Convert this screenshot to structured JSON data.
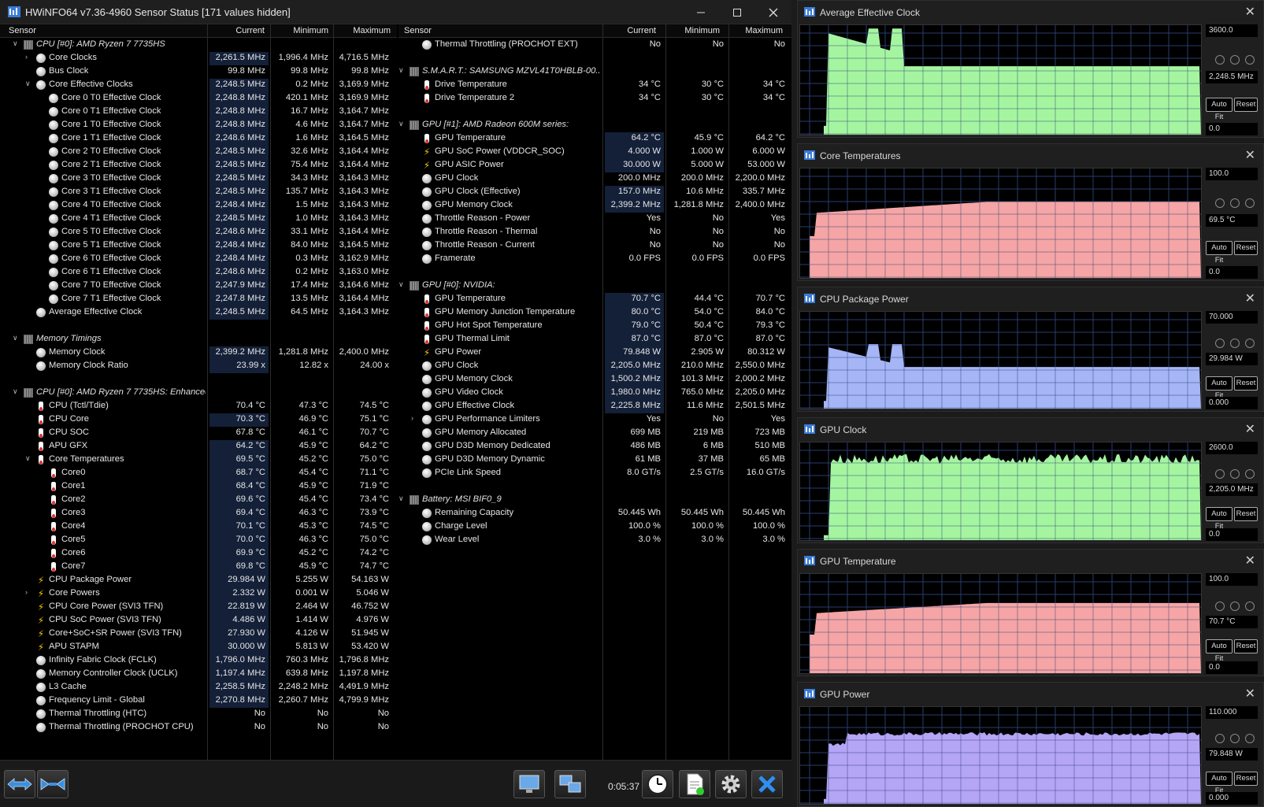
{
  "window": {
    "title": "HWiNFO64 v7.36-4960 Sensor Status [171 values hidden]",
    "icons": {
      "app": "hwinfo-icon",
      "minimize": "minimize-icon",
      "maximize": "maximize-icon",
      "close": "close-icon"
    }
  },
  "columns": {
    "sensor": "Sensor",
    "current": "Current",
    "minimum": "Minimum",
    "maximum": "Maximum"
  },
  "left_rows": [
    {
      "indent": 0,
      "expand": "down",
      "icon": "chip",
      "label": "CPU [#0]: AMD Ryzen 7 7735HS",
      "group": true
    },
    {
      "indent": 1,
      "expand": "right",
      "icon": "circle",
      "label": "Core Clocks",
      "cur": "2,261.5 MHz",
      "min": "1,996.4 MHz",
      "max": "4,716.5 MHz",
      "hl": true
    },
    {
      "indent": 1,
      "icon": "circle",
      "label": "Bus Clock",
      "cur": "99.8 MHz",
      "min": "99.8 MHz",
      "max": "99.8 MHz"
    },
    {
      "indent": 1,
      "expand": "down",
      "icon": "circle",
      "label": "Core Effective Clocks",
      "cur": "2,248.5 MHz",
      "min": "0.2 MHz",
      "max": "3,169.9 MHz",
      "hl": true
    },
    {
      "indent": 2,
      "icon": "circle",
      "label": "Core 0 T0 Effective Clock",
      "cur": "2,248.8 MHz",
      "min": "420.1 MHz",
      "max": "3,169.9 MHz",
      "hl": true
    },
    {
      "indent": 2,
      "icon": "circle",
      "label": "Core 0 T1 Effective Clock",
      "cur": "2,248.8 MHz",
      "min": "16.7 MHz",
      "max": "3,164.7 MHz",
      "hl": true
    },
    {
      "indent": 2,
      "icon": "circle",
      "label": "Core 1 T0 Effective Clock",
      "cur": "2,248.8 MHz",
      "min": "4.6 MHz",
      "max": "3,164.7 MHz",
      "hl": true
    },
    {
      "indent": 2,
      "icon": "circle",
      "label": "Core 1 T1 Effective Clock",
      "cur": "2,248.6 MHz",
      "min": "1.6 MHz",
      "max": "3,164.5 MHz",
      "hl": true
    },
    {
      "indent": 2,
      "icon": "circle",
      "label": "Core 2 T0 Effective Clock",
      "cur": "2,248.5 MHz",
      "min": "32.6 MHz",
      "max": "3,164.4 MHz",
      "hl": true
    },
    {
      "indent": 2,
      "icon": "circle",
      "label": "Core 2 T1 Effective Clock",
      "cur": "2,248.5 MHz",
      "min": "75.4 MHz",
      "max": "3,164.4 MHz",
      "hl": true
    },
    {
      "indent": 2,
      "icon": "circle",
      "label": "Core 3 T0 Effective Clock",
      "cur": "2,248.5 MHz",
      "min": "34.3 MHz",
      "max": "3,164.3 MHz",
      "hl": true
    },
    {
      "indent": 2,
      "icon": "circle",
      "label": "Core 3 T1 Effective Clock",
      "cur": "2,248.5 MHz",
      "min": "135.7 MHz",
      "max": "3,164.3 MHz",
      "hl": true
    },
    {
      "indent": 2,
      "icon": "circle",
      "label": "Core 4 T0 Effective Clock",
      "cur": "2,248.4 MHz",
      "min": "1.5 MHz",
      "max": "3,164.3 MHz",
      "hl": true
    },
    {
      "indent": 2,
      "icon": "circle",
      "label": "Core 4 T1 Effective Clock",
      "cur": "2,248.5 MHz",
      "min": "1.0 MHz",
      "max": "3,164.3 MHz",
      "hl": true
    },
    {
      "indent": 2,
      "icon": "circle",
      "label": "Core 5 T0 Effective Clock",
      "cur": "2,248.6 MHz",
      "min": "33.1 MHz",
      "max": "3,164.4 MHz",
      "hl": true
    },
    {
      "indent": 2,
      "icon": "circle",
      "label": "Core 5 T1 Effective Clock",
      "cur": "2,248.4 MHz",
      "min": "84.0 MHz",
      "max": "3,164.5 MHz",
      "hl": true
    },
    {
      "indent": 2,
      "icon": "circle",
      "label": "Core 6 T0 Effective Clock",
      "cur": "2,248.4 MHz",
      "min": "0.3 MHz",
      "max": "3,162.9 MHz",
      "hl": true
    },
    {
      "indent": 2,
      "icon": "circle",
      "label": "Core 6 T1 Effective Clock",
      "cur": "2,248.6 MHz",
      "min": "0.2 MHz",
      "max": "3,163.0 MHz",
      "hl": true
    },
    {
      "indent": 2,
      "icon": "circle",
      "label": "Core 7 T0 Effective Clock",
      "cur": "2,247.9 MHz",
      "min": "17.4 MHz",
      "max": "3,164.6 MHz",
      "hl": true
    },
    {
      "indent": 2,
      "icon": "circle",
      "label": "Core 7 T1 Effective Clock",
      "cur": "2,247.8 MHz",
      "min": "13.5 MHz",
      "max": "3,164.4 MHz",
      "hl": true
    },
    {
      "indent": 1,
      "icon": "circle",
      "label": "Average Effective Clock",
      "cur": "2,248.5 MHz",
      "min": "64.5 MHz",
      "max": "3,164.3 MHz",
      "hl": true
    },
    {
      "blank": true
    },
    {
      "indent": 0,
      "expand": "down",
      "icon": "chip",
      "label": "Memory Timings",
      "group": true
    },
    {
      "indent": 1,
      "icon": "circle",
      "label": "Memory Clock",
      "cur": "2,399.2 MHz",
      "min": "1,281.8 MHz",
      "max": "2,400.0 MHz",
      "hl": true
    },
    {
      "indent": 1,
      "icon": "circle",
      "label": "Memory Clock Ratio",
      "cur": "23.99 x",
      "min": "12.82 x",
      "max": "24.00 x",
      "hl": true
    },
    {
      "blank": true
    },
    {
      "indent": 0,
      "expand": "down",
      "icon": "chip",
      "label": "CPU [#0]: AMD Ryzen 7 7735HS: Enhanced",
      "group": true
    },
    {
      "indent": 1,
      "icon": "therm",
      "label": "CPU (Tctl/Tdie)",
      "cur": "70.4 °C",
      "min": "47.3 °C",
      "max": "74.5 °C"
    },
    {
      "indent": 1,
      "icon": "therm",
      "label": "CPU Core",
      "cur": "70.3 °C",
      "min": "46.9 °C",
      "max": "75.1 °C",
      "hl": true
    },
    {
      "indent": 1,
      "icon": "therm",
      "label": "CPU SOC",
      "cur": "67.8 °C",
      "min": "46.1 °C",
      "max": "70.7 °C"
    },
    {
      "indent": 1,
      "icon": "therm",
      "label": "APU GFX",
      "cur": "64.2 °C",
      "min": "45.9 °C",
      "max": "64.2 °C",
      "hl": true
    },
    {
      "indent": 1,
      "expand": "down",
      "icon": "therm",
      "label": "Core Temperatures",
      "cur": "69.5 °C",
      "min": "45.2 °C",
      "max": "75.0 °C",
      "hl": true
    },
    {
      "indent": 2,
      "icon": "therm",
      "label": "Core0",
      "cur": "68.7 °C",
      "min": "45.4 °C",
      "max": "71.1 °C",
      "hl": true
    },
    {
      "indent": 2,
      "icon": "therm",
      "label": "Core1",
      "cur": "68.4 °C",
      "min": "45.9 °C",
      "max": "71.9 °C",
      "hl": true
    },
    {
      "indent": 2,
      "icon": "therm",
      "label": "Core2",
      "cur": "69.6 °C",
      "min": "45.4 °C",
      "max": "73.4 °C",
      "hl": true
    },
    {
      "indent": 2,
      "icon": "therm",
      "label": "Core3",
      "cur": "69.4 °C",
      "min": "46.3 °C",
      "max": "73.9 °C",
      "hl": true
    },
    {
      "indent": 2,
      "icon": "therm",
      "label": "Core4",
      "cur": "70.1 °C",
      "min": "45.3 °C",
      "max": "74.5 °C",
      "hl": true
    },
    {
      "indent": 2,
      "icon": "therm",
      "label": "Core5",
      "cur": "70.0 °C",
      "min": "46.3 °C",
      "max": "75.0 °C",
      "hl": true
    },
    {
      "indent": 2,
      "icon": "therm",
      "label": "Core6",
      "cur": "69.9 °C",
      "min": "45.2 °C",
      "max": "74.2 °C",
      "hl": true
    },
    {
      "indent": 2,
      "icon": "therm",
      "label": "Core7",
      "cur": "69.8 °C",
      "min": "45.9 °C",
      "max": "74.7 °C",
      "hl": true
    },
    {
      "indent": 1,
      "icon": "bolt",
      "label": "CPU Package Power",
      "cur": "29.984 W",
      "min": "5.255 W",
      "max": "54.163 W",
      "hl": true
    },
    {
      "indent": 1,
      "expand": "right",
      "icon": "bolt",
      "label": "Core Powers",
      "cur": "2.332 W",
      "min": "0.001 W",
      "max": "5.046 W",
      "hl": true
    },
    {
      "indent": 1,
      "icon": "bolt",
      "label": "CPU Core Power (SVI3 TFN)",
      "cur": "22.819 W",
      "min": "2.464 W",
      "max": "46.752 W",
      "hl": true
    },
    {
      "indent": 1,
      "icon": "bolt",
      "label": "CPU SoC Power (SVI3 TFN)",
      "cur": "4.486 W",
      "min": "1.414 W",
      "max": "4.976 W",
      "hl": true
    },
    {
      "indent": 1,
      "icon": "bolt",
      "label": "Core+SoC+SR Power (SVI3 TFN)",
      "cur": "27.930 W",
      "min": "4.126 W",
      "max": "51.945 W",
      "hl": true
    },
    {
      "indent": 1,
      "icon": "bolt",
      "label": "APU STAPM",
      "cur": "30.000 W",
      "min": "5.813 W",
      "max": "53.420 W",
      "hl": true
    },
    {
      "indent": 1,
      "icon": "circle",
      "label": "Infinity Fabric Clock (FCLK)",
      "cur": "1,796.0 MHz",
      "min": "760.3 MHz",
      "max": "1,796.8 MHz",
      "hl": true
    },
    {
      "indent": 1,
      "icon": "circle",
      "label": "Memory Controller Clock (UCLK)",
      "cur": "1,197.4 MHz",
      "min": "639.8 MHz",
      "max": "1,197.8 MHz",
      "hl": true
    },
    {
      "indent": 1,
      "icon": "circle",
      "label": "L3 Cache",
      "cur": "2,258.5 MHz",
      "min": "2,248.2 MHz",
      "max": "4,491.9 MHz",
      "hl": true
    },
    {
      "indent": 1,
      "icon": "circle",
      "label": "Frequency Limit - Global",
      "cur": "2,270.8 MHz",
      "min": "2,260.7 MHz",
      "max": "4,799.9 MHz",
      "hl": true
    },
    {
      "indent": 1,
      "icon": "circle",
      "label": "Thermal Throttling (HTC)",
      "cur": "No",
      "min": "No",
      "max": "No"
    },
    {
      "indent": 1,
      "icon": "circle",
      "label": "Thermal Throttling (PROCHOT CPU)",
      "cur": "No",
      "min": "No",
      "max": "No"
    }
  ],
  "right_rows": [
    {
      "indent": 1,
      "icon": "circle",
      "label": "Thermal Throttling (PROCHOT EXT)",
      "cur": "No",
      "min": "No",
      "max": "No"
    },
    {
      "blank": true
    },
    {
      "indent": 0,
      "expand": "down",
      "icon": "chip",
      "label": "S.M.A.R.T.: SAMSUNG MZVL41T0HBLB-00...",
      "group": true
    },
    {
      "indent": 1,
      "icon": "therm",
      "label": "Drive Temperature",
      "cur": "34 °C",
      "min": "30 °C",
      "max": "34 °C"
    },
    {
      "indent": 1,
      "icon": "therm",
      "label": "Drive Temperature 2",
      "cur": "34 °C",
      "min": "30 °C",
      "max": "34 °C"
    },
    {
      "blank": true
    },
    {
      "indent": 0,
      "expand": "down",
      "icon": "chip",
      "label": "GPU [#1]: AMD Radeon 600M series:",
      "group": true
    },
    {
      "indent": 1,
      "icon": "therm",
      "label": "GPU Temperature",
      "cur": "64.2 °C",
      "min": "45.9 °C",
      "max": "64.2 °C",
      "hl": true
    },
    {
      "indent": 1,
      "icon": "bolt",
      "label": "GPU SoC Power (VDDCR_SOC)",
      "cur": "4.000 W",
      "min": "1.000 W",
      "max": "6.000 W",
      "hl": true
    },
    {
      "indent": 1,
      "icon": "bolt",
      "label": "GPU ASIC Power",
      "cur": "30.000 W",
      "min": "5.000 W",
      "max": "53.000 W",
      "hl": true
    },
    {
      "indent": 1,
      "icon": "circle",
      "label": "GPU Clock",
      "cur": "200.0 MHz",
      "min": "200.0 MHz",
      "max": "2,200.0 MHz"
    },
    {
      "indent": 1,
      "icon": "circle",
      "label": "GPU Clock (Effective)",
      "cur": "157.0 MHz",
      "min": "10.6 MHz",
      "max": "335.7 MHz",
      "hl": true
    },
    {
      "indent": 1,
      "icon": "circle",
      "label": "GPU Memory Clock",
      "cur": "2,399.2 MHz",
      "min": "1,281.8 MHz",
      "max": "2,400.0 MHz",
      "hl": true
    },
    {
      "indent": 1,
      "icon": "circle",
      "label": "Throttle Reason - Power",
      "cur": "Yes",
      "min": "No",
      "max": "Yes"
    },
    {
      "indent": 1,
      "icon": "circle",
      "label": "Throttle Reason - Thermal",
      "cur": "No",
      "min": "No",
      "max": "No"
    },
    {
      "indent": 1,
      "icon": "circle",
      "label": "Throttle Reason - Current",
      "cur": "No",
      "min": "No",
      "max": "No"
    },
    {
      "indent": 1,
      "icon": "circle",
      "label": "Framerate",
      "cur": "0.0 FPS",
      "min": "0.0 FPS",
      "max": "0.0 FPS"
    },
    {
      "blank": true
    },
    {
      "indent": 0,
      "expand": "down",
      "icon": "chip",
      "label": "GPU [#0]: NVIDIA:",
      "group": true
    },
    {
      "indent": 1,
      "icon": "therm",
      "label": "GPU Temperature",
      "cur": "70.7 °C",
      "min": "44.4 °C",
      "max": "70.7 °C",
      "hl": true
    },
    {
      "indent": 1,
      "icon": "therm",
      "label": "GPU Memory Junction Temperature",
      "cur": "80.0 °C",
      "min": "54.0 °C",
      "max": "84.0 °C",
      "hl": true
    },
    {
      "indent": 1,
      "icon": "therm",
      "label": "GPU Hot Spot Temperature",
      "cur": "79.0 °C",
      "min": "50.4 °C",
      "max": "79.3 °C",
      "hl": true
    },
    {
      "indent": 1,
      "icon": "therm",
      "label": "GPU Thermal Limit",
      "cur": "87.0 °C",
      "min": "87.0 °C",
      "max": "87.0 °C",
      "hl": true
    },
    {
      "indent": 1,
      "icon": "bolt",
      "label": "GPU Power",
      "cur": "79.848 W",
      "min": "2.905 W",
      "max": "80.312 W",
      "hl": true
    },
    {
      "indent": 1,
      "icon": "circle",
      "label": "GPU Clock",
      "cur": "2,205.0 MHz",
      "min": "210.0 MHz",
      "max": "2,550.0 MHz",
      "hl": true
    },
    {
      "indent": 1,
      "icon": "circle",
      "label": "GPU Memory Clock",
      "cur": "1,500.2 MHz",
      "min": "101.3 MHz",
      "max": "2,000.2 MHz",
      "hl": true
    },
    {
      "indent": 1,
      "icon": "circle",
      "label": "GPU Video Clock",
      "cur": "1,980.0 MHz",
      "min": "765.0 MHz",
      "max": "2,205.0 MHz",
      "hl": true
    },
    {
      "indent": 1,
      "icon": "circle",
      "label": "GPU Effective Clock",
      "cur": "2,225.8 MHz",
      "min": "11.6 MHz",
      "max": "2,501.5 MHz",
      "hl": true
    },
    {
      "indent": 1,
      "expand": "right",
      "icon": "circle",
      "label": "GPU Performance Limiters",
      "cur": "Yes",
      "min": "No",
      "max": "Yes"
    },
    {
      "indent": 1,
      "icon": "circle",
      "label": "GPU Memory Allocated",
      "cur": "699 MB",
      "min": "219 MB",
      "max": "723 MB"
    },
    {
      "indent": 1,
      "icon": "circle",
      "label": "GPU D3D Memory Dedicated",
      "cur": "486 MB",
      "min": "6 MB",
      "max": "510 MB"
    },
    {
      "indent": 1,
      "icon": "circle",
      "label": "GPU D3D Memory Dynamic",
      "cur": "61 MB",
      "min": "37 MB",
      "max": "65 MB"
    },
    {
      "indent": 1,
      "icon": "circle",
      "label": "PCIe Link Speed",
      "cur": "8.0 GT/s",
      "min": "2.5 GT/s",
      "max": "16.0 GT/s"
    },
    {
      "blank": true
    },
    {
      "indent": 0,
      "expand": "down",
      "icon": "chip",
      "label": "Battery: MSI BIF0_9",
      "group": true
    },
    {
      "indent": 1,
      "icon": "circle",
      "label": "Remaining Capacity",
      "cur": "50.445 Wh",
      "min": "50.445 Wh",
      "max": "50.445 Wh"
    },
    {
      "indent": 1,
      "icon": "circle",
      "label": "Charge Level",
      "cur": "100.0 %",
      "min": "100.0 %",
      "max": "100.0 %"
    },
    {
      "indent": 1,
      "icon": "circle",
      "label": "Wear Level",
      "cur": "3.0 %",
      "min": "3.0 %",
      "max": "3.0 %"
    }
  ],
  "bottom": {
    "timer": "0:05:37",
    "buttons": [
      "expand-all-button",
      "collapse-all-button",
      "network-button",
      "remote-button",
      "clock-button",
      "log-button",
      "settings-button",
      "exit-button"
    ]
  },
  "graphs": [
    {
      "title": "Average Effective Clock",
      "max": "3600.0",
      "current": "2,248.5 MHz",
      "min": "0.0",
      "color": "#a5f5a0",
      "level": 0.625,
      "shape": "spikes"
    },
    {
      "title": "Core Temperatures",
      "max": "100.0",
      "current": "69.5 °C",
      "min": "0.0",
      "color": "#f5a5a5",
      "level": 0.695,
      "shape": "ramp"
    },
    {
      "title": "CPU Package Power",
      "max": "70.000",
      "current": "29.984 W",
      "min": "0.000",
      "color": "#a5b5f5",
      "level": 0.43,
      "shape": "spikes"
    },
    {
      "title": "GPU Clock",
      "max": "2600.0",
      "current": "2,205.0 MHz",
      "min": "0.0",
      "color": "#a5f5a0",
      "level": 0.848,
      "shape": "noisy"
    },
    {
      "title": "GPU Temperature",
      "max": "100.0",
      "current": "70.7 °C",
      "min": "0.0",
      "color": "#f5a5a5",
      "level": 0.707,
      "shape": "ramp"
    },
    {
      "title": "GPU Power",
      "max": "110.000",
      "current": "79.848 W",
      "min": "0.000",
      "color": "#b5a5f5",
      "level": 0.726,
      "shape": "plateau"
    }
  ],
  "graph_buttons": {
    "auto_fit": "Auto Fit",
    "reset": "Reset"
  }
}
